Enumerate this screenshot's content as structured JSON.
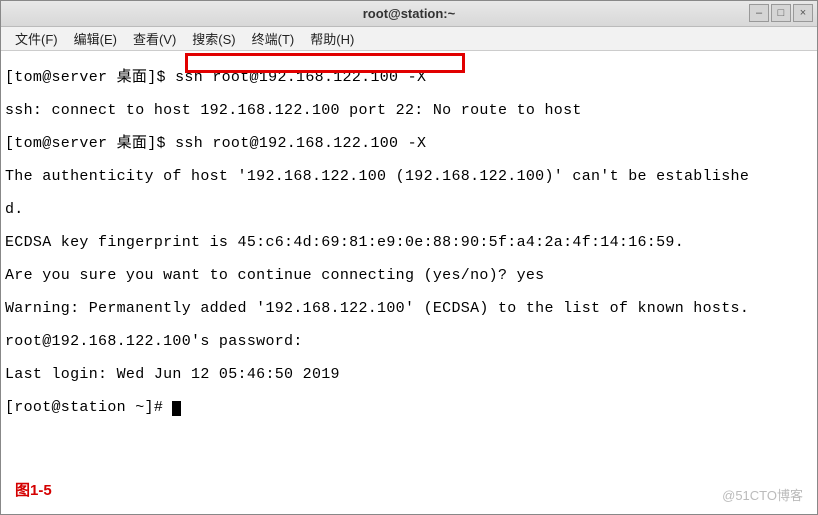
{
  "window": {
    "title": "root@station:~",
    "controls": {
      "min": "–",
      "max": "□",
      "close": "×"
    }
  },
  "menu": {
    "file": "文件(F)",
    "edit": "编辑(E)",
    "view": "查看(V)",
    "search": "搜索(S)",
    "terminal": "终端(T)",
    "help": "帮助(H)"
  },
  "terminal": {
    "l1a": "[tom@server 桌面]$ ",
    "l1b": "ssh root@192.168.122.100 -X",
    "l2": "ssh: connect to host 192.168.122.100 port 22: No route to host",
    "l3": "[tom@server 桌面]$ ssh root@192.168.122.100 -X",
    "l4": "The authenticity of host '192.168.122.100 (192.168.122.100)' can't be establishe",
    "l5": "d.",
    "l6": "ECDSA key fingerprint is 45:c6:4d:69:81:e9:0e:88:90:5f:a4:2a:4f:14:16:59.",
    "l7": "Are you sure you want to continue connecting (yes/no)? yes",
    "l8": "Warning: Permanently added '192.168.122.100' (ECDSA) to the list of known hosts.",
    "l9": "root@192.168.122.100's password:",
    "l10": "Last login: Wed Jun 12 05:46:50 2019",
    "l11": "[root@station ~]# "
  },
  "caption": "图1-5",
  "watermark": "@51CTO博客"
}
